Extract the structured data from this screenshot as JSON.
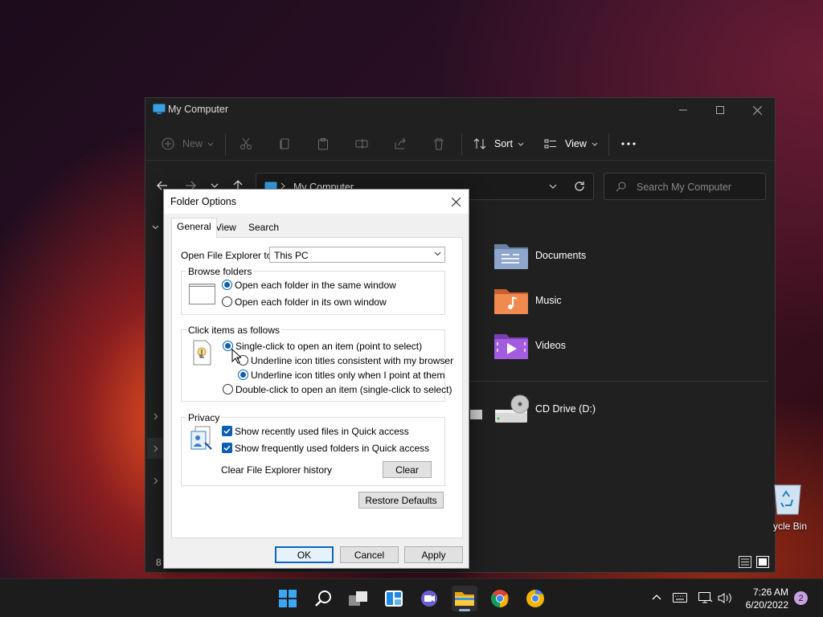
{
  "explorer": {
    "title": "My Computer",
    "commands": {
      "new": "New",
      "sort": "Sort",
      "view": "View"
    },
    "address": "My Computer",
    "search_placeholder": "Search My Computer",
    "items": [
      {
        "label": "Documents",
        "icon": "documents-folder-icon"
      },
      {
        "label": "Music",
        "icon": "music-folder-icon"
      },
      {
        "label": "Videos",
        "icon": "videos-folder-icon"
      },
      {
        "label": "CD Drive (D:)",
        "icon": "cd-drive-icon"
      }
    ],
    "status_count": "8"
  },
  "desktop": {
    "recycle_bin_label": "ycle Bin"
  },
  "dialog": {
    "title": "Folder Options",
    "tabs": [
      "General",
      "View",
      "Search"
    ],
    "active_tab": "General",
    "open_to_label": "Open File Explorer to:",
    "open_to_value": "This PC",
    "browse": {
      "title": "Browse folders",
      "options": [
        "Open each folder in the same window",
        "Open each folder in its own window"
      ],
      "selected": 0
    },
    "click": {
      "title": "Click items as follows",
      "single": "Single-click to open an item (point to select)",
      "underline_browser": "Underline icon titles consistent with my browser",
      "underline_point": "Underline icon titles only when I point at them",
      "double": "Double-click to open an item (single-click to select)",
      "selected": "single",
      "underline_selected": "underline_point"
    },
    "privacy": {
      "title": "Privacy",
      "recent_files": "Show recently used files in Quick access",
      "frequent_folders": "Show frequently used folders in Quick access",
      "recent_checked": true,
      "frequent_checked": true,
      "clear_history_label": "Clear File Explorer history",
      "clear_button": "Clear"
    },
    "restore_defaults": "Restore Defaults",
    "ok": "OK",
    "cancel": "Cancel",
    "apply": "Apply"
  },
  "taskbar": {
    "time": "7:26 AM",
    "date": "6/20/2022",
    "notification_count": "2"
  },
  "colors": {
    "accent": "#0a5fb4",
    "explorer_bg": "#202020",
    "taskbar_bg": "#1c1c1c"
  }
}
